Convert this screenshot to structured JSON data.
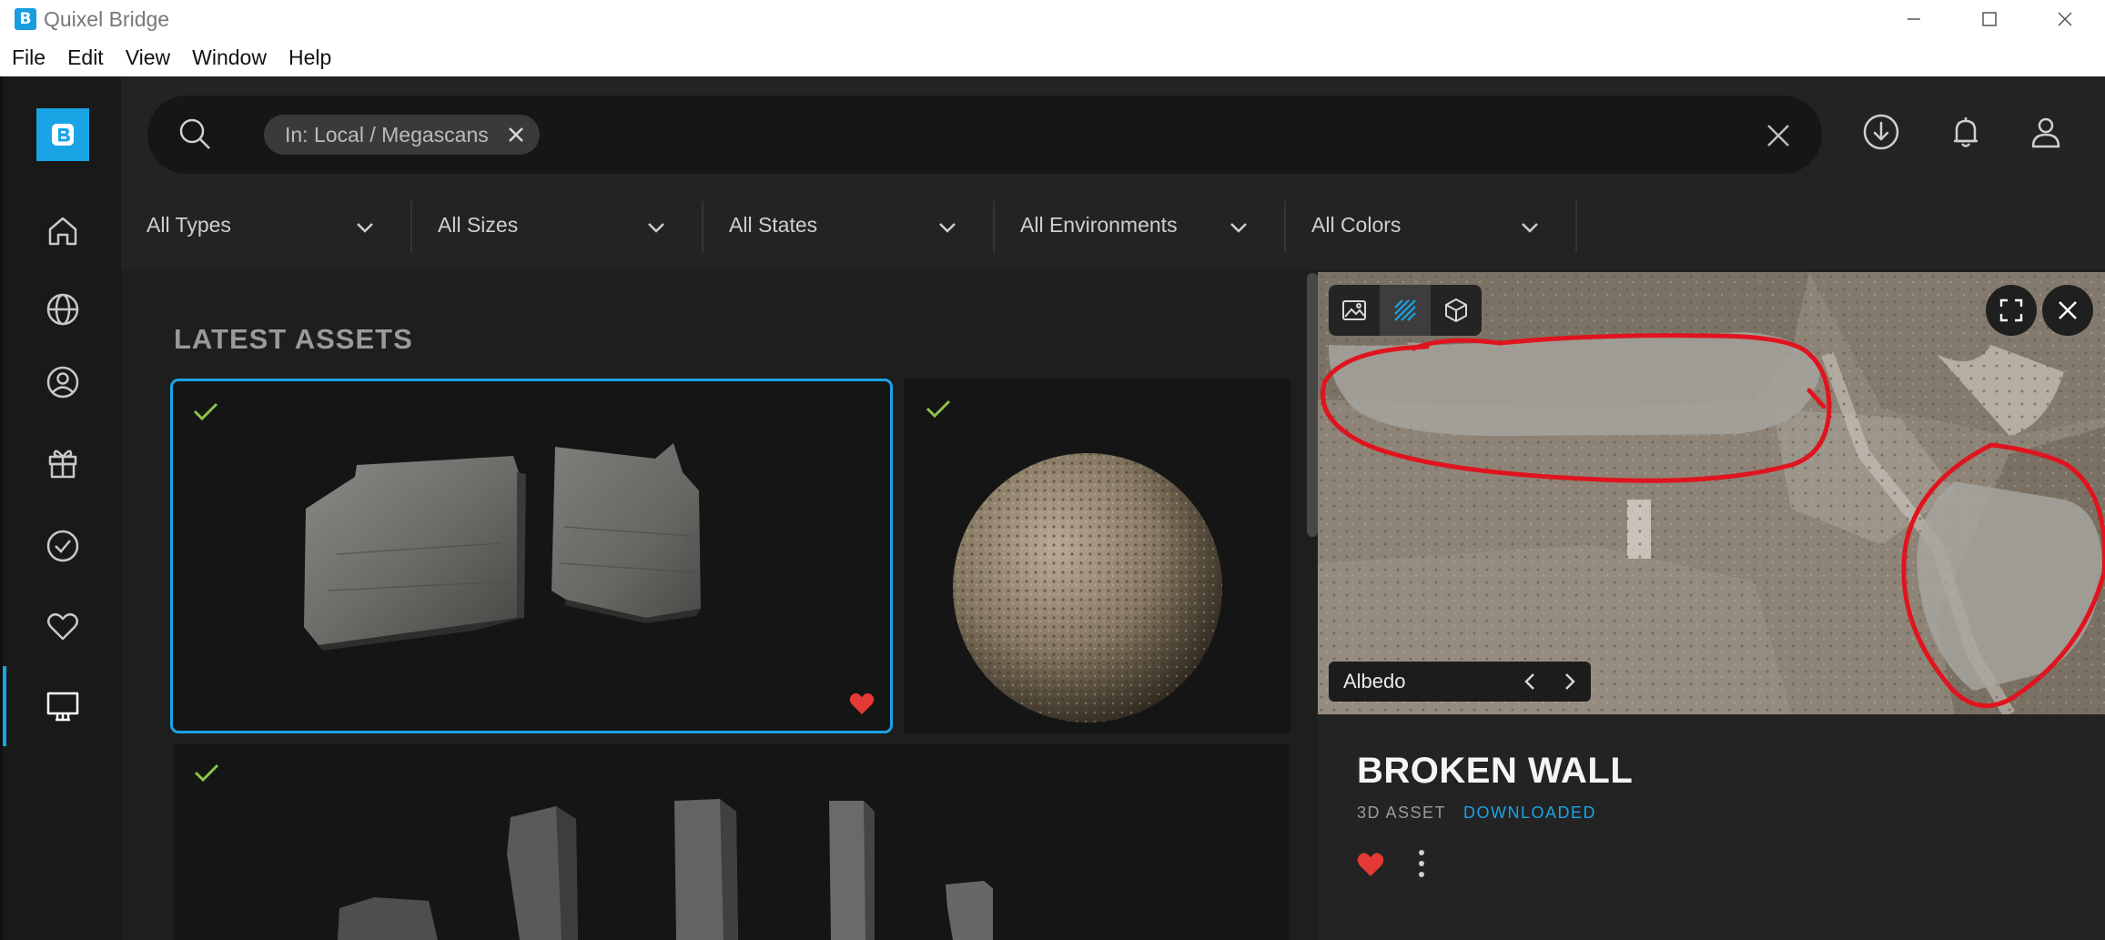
{
  "window": {
    "title": "Quixel Bridge",
    "logo_letter": "B"
  },
  "menu": [
    "File",
    "Edit",
    "View",
    "Window",
    "Help"
  ],
  "search": {
    "filter_chip": "In: Local / Megascans"
  },
  "filters": [
    "All Types",
    "All Sizes",
    "All States",
    "All Environments",
    "All Colors"
  ],
  "sidebar_icons": [
    "home-icon",
    "globe-icon",
    "user-circle-icon",
    "gift-icon",
    "check-circle-icon",
    "heart-icon",
    "monitor-icon"
  ],
  "main": {
    "section_title": "LATEST ASSETS"
  },
  "detail": {
    "map_label": "Albedo",
    "asset_name": "BROKEN WALL",
    "asset_type": "3D ASSET",
    "asset_state": "DOWNLOADED"
  },
  "colors": {
    "accent": "#1aa4e6",
    "check": "#8bc34a",
    "favorite": "#e53935",
    "annotation": "#e0141e"
  }
}
